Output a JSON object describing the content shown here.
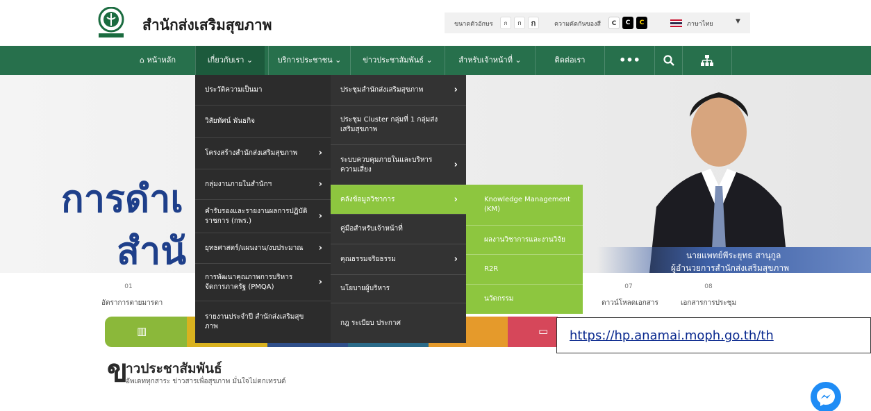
{
  "header": {
    "site_title": "สำนักส่งเสริมสุขภาพ",
    "font_size_label": "ขนาดตัวอักษร",
    "font_sizes": [
      "ก",
      "ก",
      "ก"
    ],
    "contrast_label": "ความคัดกันของสี",
    "contrast_options": [
      "C",
      "C",
      "C"
    ],
    "language": "ภาษาไทย"
  },
  "nav": {
    "items": [
      {
        "label": "หน้าหลัก"
      },
      {
        "label": "เกี่ยวกับเรา ⌄"
      },
      {
        "label": "บริการประชาชน ⌄"
      },
      {
        "label": "ข่าวประชาสัมพันธ์ ⌄"
      },
      {
        "label": "สำหรับเจ้าหน้าที่ ⌄"
      },
      {
        "label": "ติดต่อเรา"
      }
    ],
    "more_icon": "•••"
  },
  "hero": {
    "line1": "การดำเ",
    "line2": "สำนั",
    "dots": "▪▪▪▪▪",
    "person_name": "นายแพทย์พีระยุทธ สานุกูล",
    "person_title": "ผู้อำนวยการสำนักส่งเสริมสุขภาพ"
  },
  "strip": {
    "items": [
      {
        "num": "01",
        "label": "อัตราการตายมารดา"
      },
      {
        "num": "07",
        "label": "ดาวน์โหลดเอกสาร"
      },
      {
        "num": "08",
        "label": "เอกสารการประชุม"
      }
    ]
  },
  "dropdown": {
    "col1": [
      {
        "label": "ประวัติความเป็นมา",
        "arrow": ""
      },
      {
        "label": "วิสัยทัศน์ พันธกิจ",
        "arrow": ""
      },
      {
        "label": "โครงสร้างสำนักส่งเสริมสุขภาพ",
        "arrow": "›"
      },
      {
        "label": "กลุ่มงานภายในสำนักฯ",
        "arrow": "›"
      },
      {
        "label": "คำรับรองและรายงานผลการปฏิบัติราชการ (กพร.)",
        "arrow": "›"
      },
      {
        "label": "ยุทธศาสตร์/แผนงาน/งบประมาณ",
        "arrow": "›"
      },
      {
        "label": "การพัฒนาคุณภาพการบริหารจัดการภาครัฐ (PMQA)",
        "arrow": "›"
      },
      {
        "label": "รายงานประจำปี สำนักส่งเสริมสุขภาพ",
        "arrow": ""
      }
    ],
    "col2": [
      {
        "label": "ประชุมสำนักส่งเสริมสุขภาพ",
        "arrow": "›"
      },
      {
        "label": "ประชุม Cluster กลุ่มที่ 1 กลุ่มส่งเสริมสุขภาพ",
        "arrow": ""
      },
      {
        "label": "ระบบควบคุมภายในและบริหารความเสี่ยง",
        "arrow": "›"
      },
      {
        "label": "คลังข้อมูลวิชาการ",
        "arrow": "›"
      },
      {
        "label": "คู่มือสำหรับเจ้าหน้าที่",
        "arrow": ""
      },
      {
        "label": "คุณธรรมจริยธรรม",
        "arrow": "›"
      },
      {
        "label": "นโยบายผู้บริหาร",
        "arrow": ""
      },
      {
        "label": "กฎ ระเบียบ ประกาศ",
        "arrow": ""
      }
    ],
    "col3": [
      {
        "label": "Knowledge Management (KM)"
      },
      {
        "label": "ผลงานวิชาการและงานวิจัย"
      },
      {
        "label": "R2R"
      },
      {
        "label": "นวัตกรรม"
      }
    ]
  },
  "news": {
    "title": "าวประชาสัมพันธ์",
    "subtitle": "อัพเดททุกสาระ ข่าวสารเพื่อสุขภาพ มั่นใจไม่ตกเทรนด์",
    "v": "ข"
  },
  "url": "https://hp.anamai.moph.go.th/th",
  "colors": {
    "nav_green": "#27704c",
    "menu_dark": "#2c2c2c",
    "menu_active": "#8dc63f",
    "hero_blue": "#1e3f8a"
  }
}
